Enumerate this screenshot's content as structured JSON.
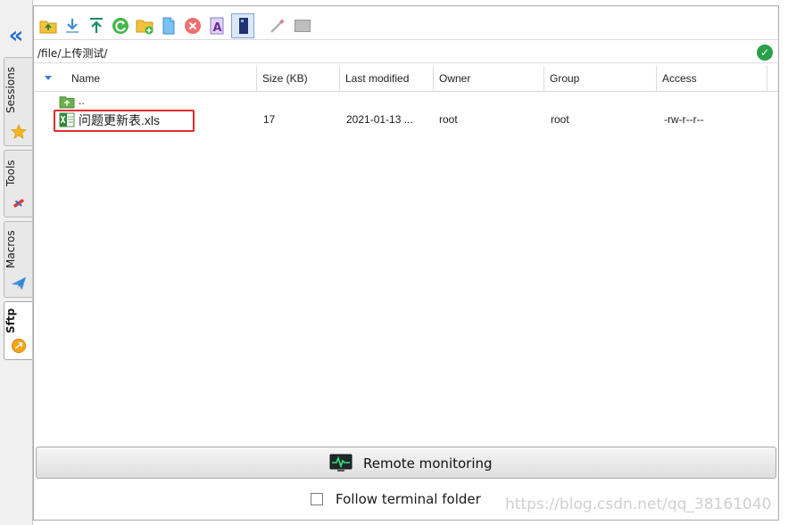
{
  "sidebar": {
    "collapse_icon": "double-chevron-left-icon",
    "tabs": [
      {
        "label": "Sessions",
        "icon": "star-icon"
      },
      {
        "label": "Tools",
        "icon": "tools-icon"
      },
      {
        "label": "Macros",
        "icon": "paper-plane-icon"
      },
      {
        "label": "Sftp",
        "icon": "sftp-icon",
        "active": true
      }
    ]
  },
  "toolbar": {
    "icons": [
      "parent-folder-icon",
      "download-icon",
      "upload-icon",
      "refresh-icon",
      "new-folder-icon",
      "new-file-icon",
      "delete-icon",
      "rename-icon",
      "toggle-panel-icon",
      "magic-icon",
      "terminal-icon"
    ]
  },
  "path": {
    "value": "/file/上传测试/",
    "status_icon": "check-icon"
  },
  "table": {
    "columns": [
      "Name",
      "Size (KB)",
      "Last modified",
      "Owner",
      "Group",
      "Access"
    ],
    "rows": [
      {
        "name": "..",
        "size": "",
        "modified": "",
        "owner": "",
        "group": "",
        "access": ""
      },
      {
        "name": "问题更新表.xls",
        "size": "17",
        "modified": "2021-01-13 ...",
        "owner": "root",
        "group": "root",
        "access": "-rw-r--r--"
      }
    ]
  },
  "footer": {
    "monitor_label": "Remote monitoring",
    "follow_label": "Follow terminal folder",
    "follow_checked": false
  },
  "watermark": "https://blog.csdn.net/qq_38161040",
  "colors": {
    "accent": "#2a6fd0",
    "highlight": "#e22a2a",
    "ok": "#2aa04a"
  }
}
